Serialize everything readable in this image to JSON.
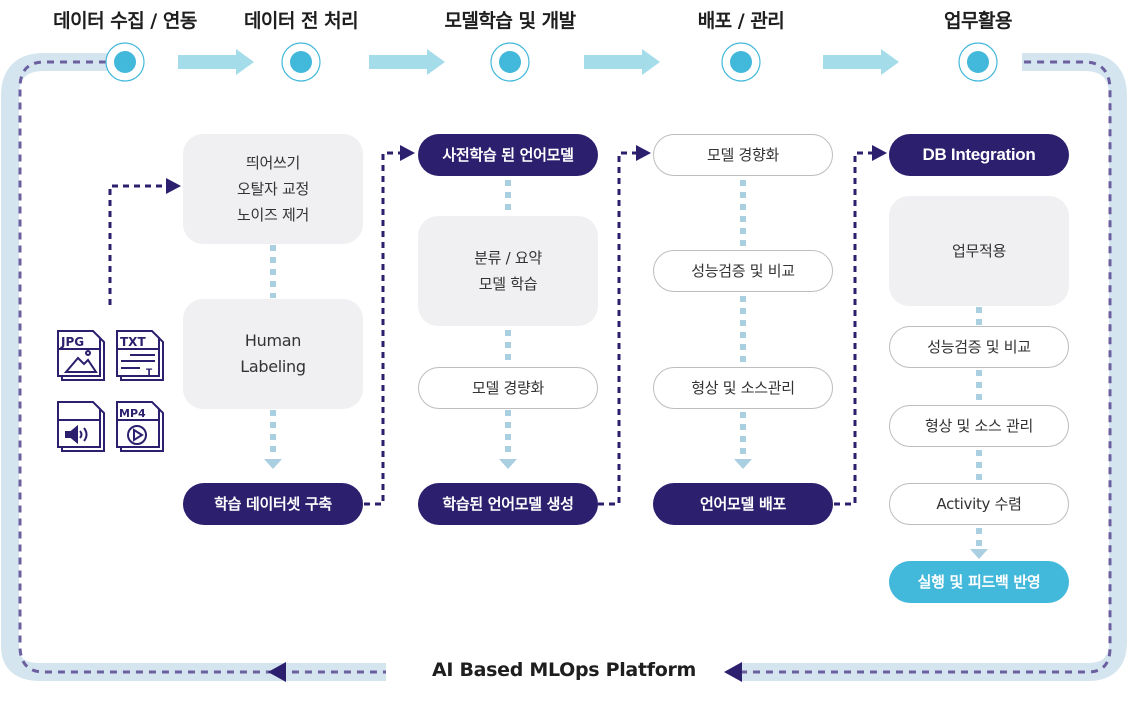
{
  "stages": [
    {
      "title": "데이터 수집 / 연동"
    },
    {
      "title": "데이터 전 처리"
    },
    {
      "title": "모델학습 및 개발"
    },
    {
      "title": "배포 / 관리"
    },
    {
      "title": "업무활용"
    }
  ],
  "source_files": [
    {
      "type": "JPG",
      "icon": "image-file-icon"
    },
    {
      "type": "TXT",
      "icon": "text-file-icon"
    },
    {
      "type": "",
      "icon": "audio-file-icon"
    },
    {
      "type": "MP4",
      "icon": "video-file-icon"
    }
  ],
  "preprocess": {
    "cleaning": [
      "띄어쓰기",
      "오탈자 교정",
      "노이즈 제거"
    ],
    "labeling": [
      "Human",
      "Labeling"
    ],
    "output": "학습 데이터셋 구축"
  },
  "training": {
    "input": "사전학습 된 언어모델",
    "step1": [
      "분류 / 요약",
      "모델 학습"
    ],
    "step2": "모델 경량화",
    "output": "학습된 언어모델 생성"
  },
  "deploy": {
    "step1": "모델 경향화",
    "step2": "성능검증 및 비교",
    "step3": "형상 및 소스관리",
    "output": "언어모델 배포"
  },
  "usage": {
    "input": "DB Integration",
    "step1": "업무적용",
    "step2": "성능검증 및 비교",
    "step3": "형상 및 소스 관리",
    "step4": "Activity 수렴",
    "output": "실행 및 피드백 반영"
  },
  "platform_label": "AI Based MLOps Platform",
  "colors": {
    "navy": "#2b1f6e",
    "cyan": "#42b8da",
    "light_blue_track": "#d4e5ef",
    "arrow_blue": "#a5dcea",
    "connector": "#a9cfe0",
    "dash_purple": "#6b5fa0"
  }
}
